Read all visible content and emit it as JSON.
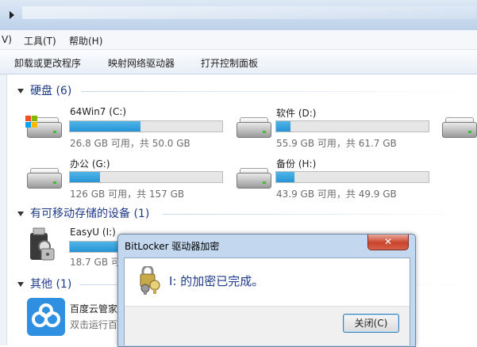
{
  "menubar": {
    "items": [
      "V)",
      "工具(T)",
      "帮助(H)"
    ]
  },
  "commandbar": {
    "items": [
      "卸载或更改程序",
      "映射网络驱动器",
      "打开控制面板"
    ]
  },
  "groups": {
    "hard_disks": {
      "label": "硬盘 (6)"
    },
    "removable": {
      "label": "有可移动存储的设备 (1)"
    },
    "other": {
      "label": "其他 (1)"
    }
  },
  "drives": [
    {
      "name": "64Win7  (C:)",
      "free_text": "26.8 GB 可用，共 50.0 GB",
      "used_fraction": 0.464,
      "icon": "system-drive-icon"
    },
    {
      "name": "软件 (D:)",
      "free_text": "55.9 GB 可用，共 61.7 GB",
      "used_fraction": 0.094,
      "icon": "hard-drive-icon"
    },
    {
      "name": "办公 (G:)",
      "free_text": "126 GB 可用，共 157 GB",
      "used_fraction": 0.197,
      "icon": "hard-drive-icon"
    },
    {
      "name": "备份 (H:)",
      "free_text": "43.9 GB 可用，共 49.9 GB",
      "used_fraction": 0.12,
      "icon": "hard-drive-icon"
    }
  ],
  "removable_drive": {
    "name": "EasyU (I:)",
    "free_text": "18.7 GB 可",
    "icon": "bitlocker-usb-icon"
  },
  "other_item": {
    "name": "百度云管家",
    "desc": "双击运行百",
    "icon": "baidu-cloud-icon"
  },
  "dialog": {
    "title": "BitLocker 驱动器加密",
    "close_glyph": "✕",
    "message": "I: 的加密已完成。",
    "button": "关闭(C)",
    "icon": "bitlocker-keys-icon"
  },
  "colors": {
    "accent": "#2694d6",
    "group_text": "#1e3a8a",
    "drive_led": "#34c534"
  }
}
